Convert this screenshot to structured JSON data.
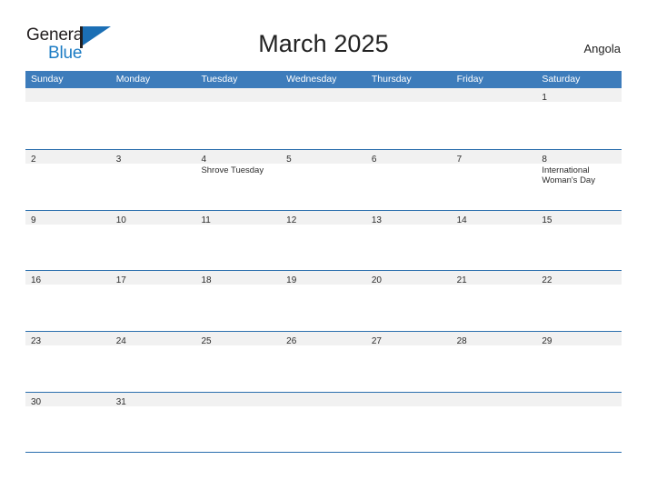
{
  "brand": {
    "name_part1": "General",
    "name_part2": "Blue",
    "flag_icon": "flag-icon",
    "colors": {
      "dark": "#231f20",
      "blue": "#1c7cc4",
      "flag": "#1b6fb5"
    }
  },
  "header": {
    "title": "March 2025",
    "locale": "Angola"
  },
  "calendar": {
    "header_color": "#3d7cbb",
    "row_border_color": "#2a6ead",
    "day_band_color": "#f1f1f1",
    "weekdays": [
      "Sunday",
      "Monday",
      "Tuesday",
      "Wednesday",
      "Thursday",
      "Friday",
      "Saturday"
    ],
    "weeks": [
      [
        {
          "day": "",
          "events": []
        },
        {
          "day": "",
          "events": []
        },
        {
          "day": "",
          "events": []
        },
        {
          "day": "",
          "events": []
        },
        {
          "day": "",
          "events": []
        },
        {
          "day": "",
          "events": []
        },
        {
          "day": "1",
          "events": []
        }
      ],
      [
        {
          "day": "2",
          "events": []
        },
        {
          "day": "3",
          "events": []
        },
        {
          "day": "4",
          "events": [
            "Shrove Tuesday"
          ]
        },
        {
          "day": "5",
          "events": []
        },
        {
          "day": "6",
          "events": []
        },
        {
          "day": "7",
          "events": []
        },
        {
          "day": "8",
          "events": [
            "International Woman's Day"
          ]
        }
      ],
      [
        {
          "day": "9",
          "events": []
        },
        {
          "day": "10",
          "events": []
        },
        {
          "day": "11",
          "events": []
        },
        {
          "day": "12",
          "events": []
        },
        {
          "day": "13",
          "events": []
        },
        {
          "day": "14",
          "events": []
        },
        {
          "day": "15",
          "events": []
        }
      ],
      [
        {
          "day": "16",
          "events": []
        },
        {
          "day": "17",
          "events": []
        },
        {
          "day": "18",
          "events": []
        },
        {
          "day": "19",
          "events": []
        },
        {
          "day": "20",
          "events": []
        },
        {
          "day": "21",
          "events": []
        },
        {
          "day": "22",
          "events": []
        }
      ],
      [
        {
          "day": "23",
          "events": []
        },
        {
          "day": "24",
          "events": []
        },
        {
          "day": "25",
          "events": []
        },
        {
          "day": "26",
          "events": []
        },
        {
          "day": "27",
          "events": []
        },
        {
          "day": "28",
          "events": []
        },
        {
          "day": "29",
          "events": []
        }
      ],
      [
        {
          "day": "30",
          "events": []
        },
        {
          "day": "31",
          "events": []
        },
        {
          "day": "",
          "events": []
        },
        {
          "day": "",
          "events": []
        },
        {
          "day": "",
          "events": []
        },
        {
          "day": "",
          "events": []
        },
        {
          "day": "",
          "events": []
        }
      ]
    ]
  }
}
